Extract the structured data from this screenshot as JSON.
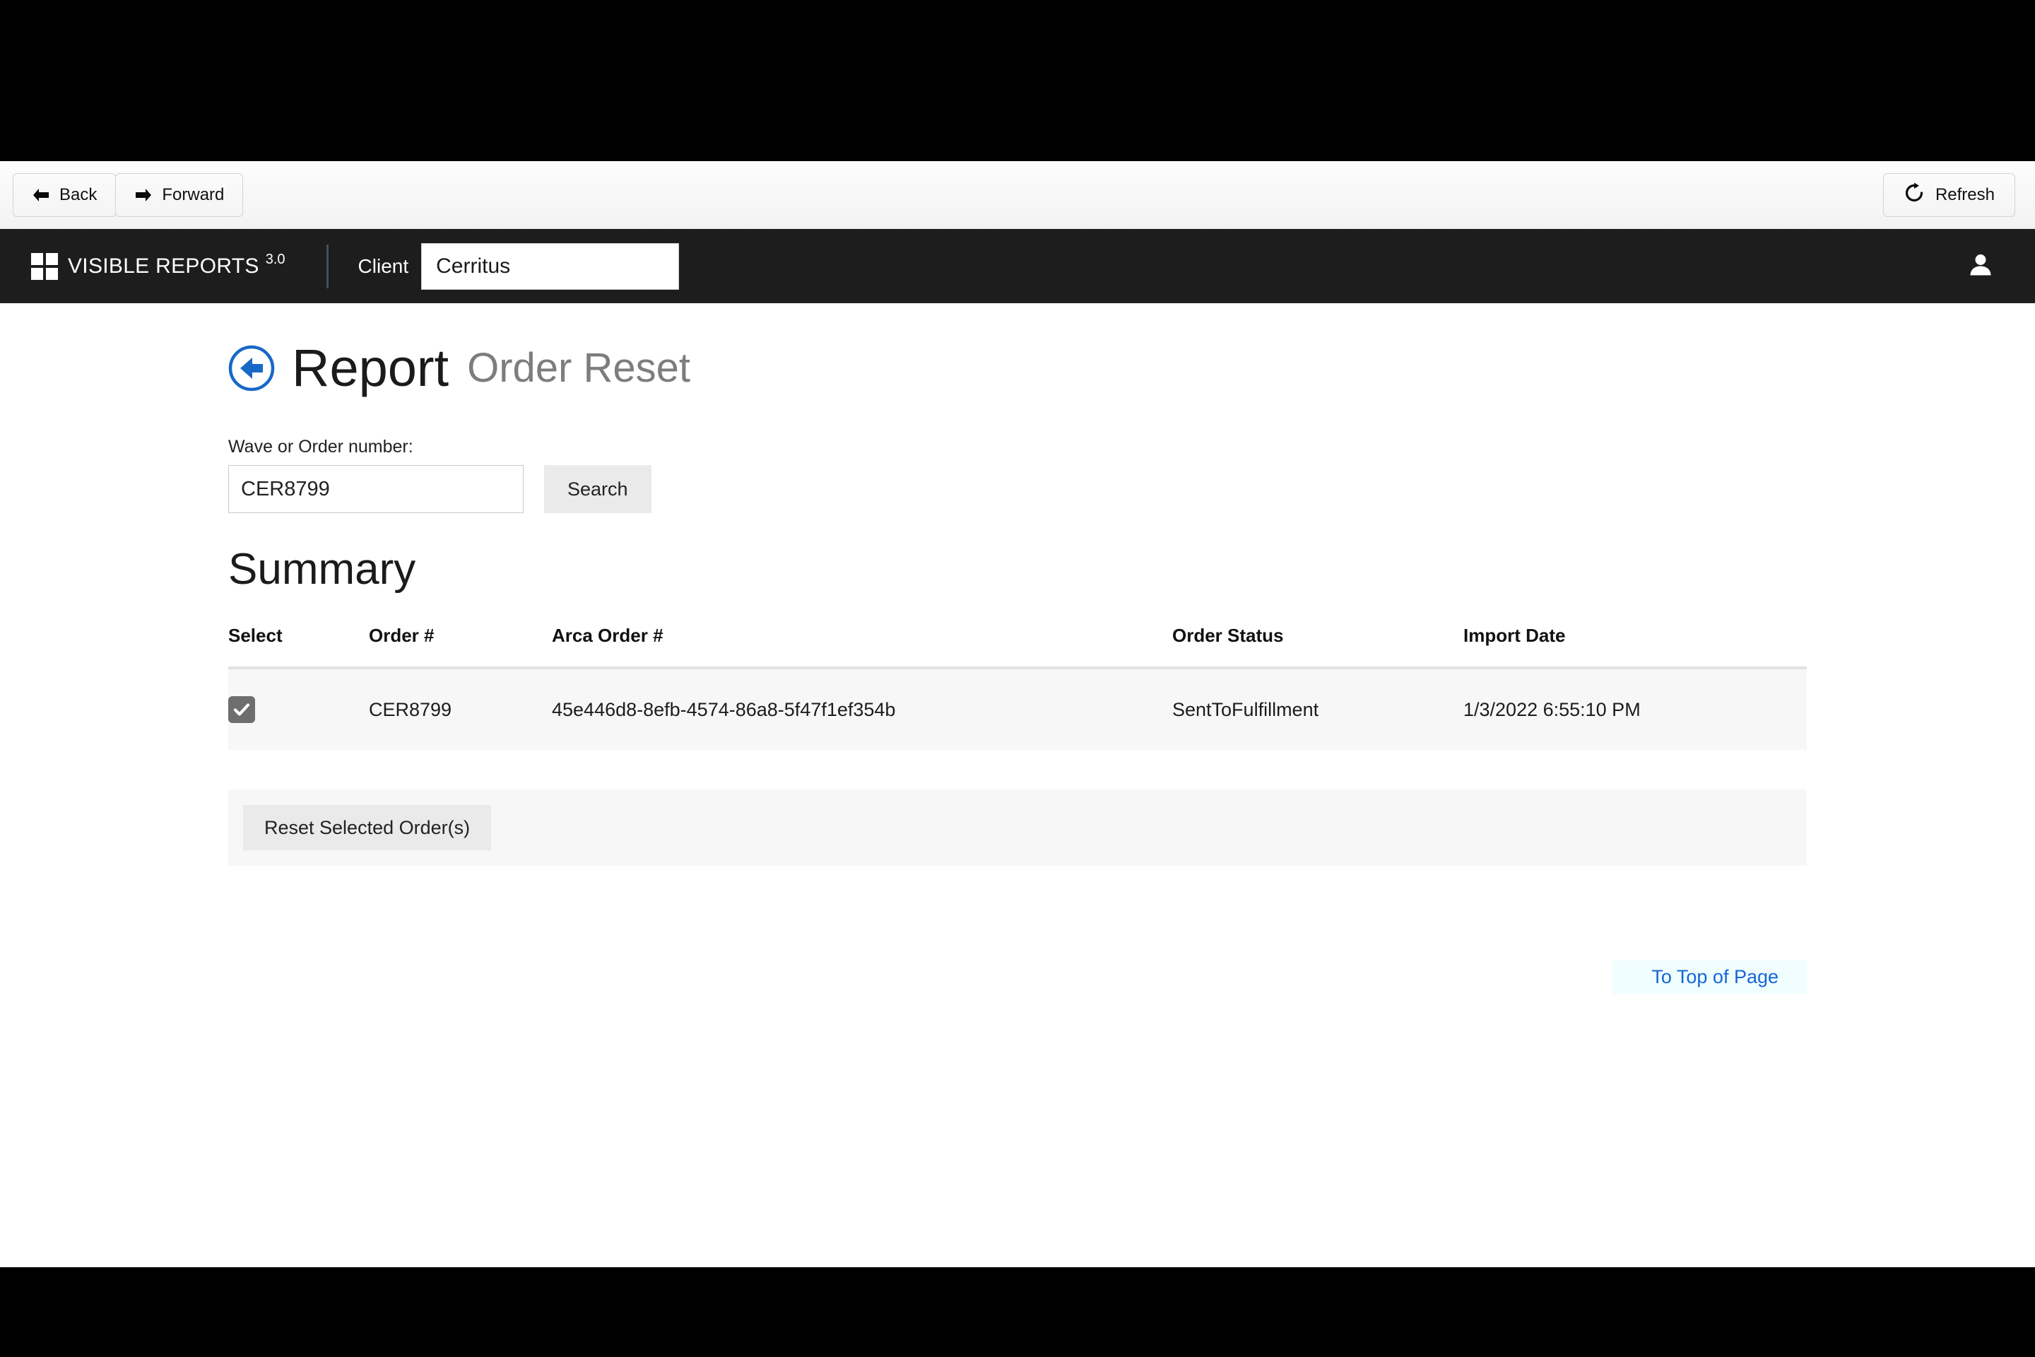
{
  "chrome": {
    "back_label": "Back",
    "forward_label": "Forward",
    "refresh_label": "Refresh"
  },
  "appbar": {
    "brand_name": "VISIBLE REPORTS",
    "brand_version": "3.0",
    "client_label": "Client",
    "client_value": "Cerritus",
    "client_placeholder": "Client",
    "account_icon": "user-icon"
  },
  "page": {
    "title": "Report",
    "subtitle": "Order Reset",
    "back_icon": "circle-arrow-left-icon",
    "search": {
      "label": "Wave or Order number:",
      "value": "CER8799",
      "placeholder": "",
      "button_label": "Search"
    },
    "summary_heading": "Summary",
    "table": {
      "columns": [
        "Select",
        "Order #",
        "Arca Order #",
        "Order Status",
        "Import Date"
      ],
      "rows": [
        {
          "selected": true,
          "order": "CER8799",
          "arca_order": "45e446d8-8efb-4574-86a8-5f47f1ef354b",
          "status": "SentToFulfillment",
          "import_date": "1/3/2022 6:55:10 PM"
        }
      ]
    },
    "reset_button_label": "Reset Selected Order(s)",
    "top_of_page_label": "To Top of Page"
  },
  "colors": {
    "appbar_bg": "#1d1d1d",
    "accent_blue": "#1565d8",
    "row_bg": "#f7f7f7",
    "checkbox_fill": "#6e6e6e",
    "toplink_bg": "#f0feff"
  }
}
